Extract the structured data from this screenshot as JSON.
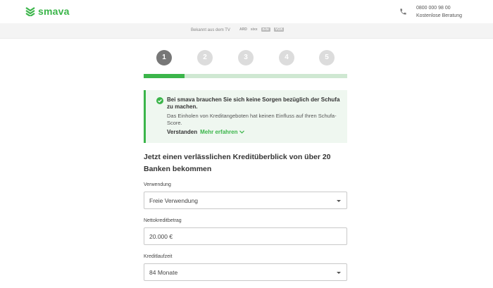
{
  "header": {
    "brand": "smava",
    "phone": "0800 000 98 00",
    "consult": "Kostenlose Beratung"
  },
  "tvbar": {
    "text": "Bekannt aus dem TV",
    "logos": [
      "ARD",
      "sixx",
      "n-tv",
      "VOX"
    ]
  },
  "steps": [
    "1",
    "2",
    "3",
    "4",
    "5"
  ],
  "progress": {
    "current_step": 1,
    "total_steps": 5,
    "fraction": 0.2
  },
  "notice": {
    "title": "Bei smava brauchen Sie sich keine Sorgen bezüglich der Schufa zu machen.",
    "text": "Das Einholen von Kreditangeboten hat keinen Einfluss auf Ihren Schufa-Score.",
    "understood": "Verstanden",
    "more": "Mehr erfahren"
  },
  "form": {
    "heading": "Jetzt einen verlässlichen Kreditüberblick von über 20 Banken bekommen",
    "fields": [
      {
        "label": "Verwendung",
        "value": "Freie Verwendung",
        "type": "select"
      },
      {
        "label": "Nettokreditbetrag",
        "value": "20.000 €",
        "type": "input"
      },
      {
        "label": "Kreditlaufzeit",
        "value": "84 Monate",
        "type": "select"
      }
    ]
  },
  "colors": {
    "brand": "#3bb54a",
    "notice_bg": "#eff7f0",
    "step_active": "#777777"
  }
}
